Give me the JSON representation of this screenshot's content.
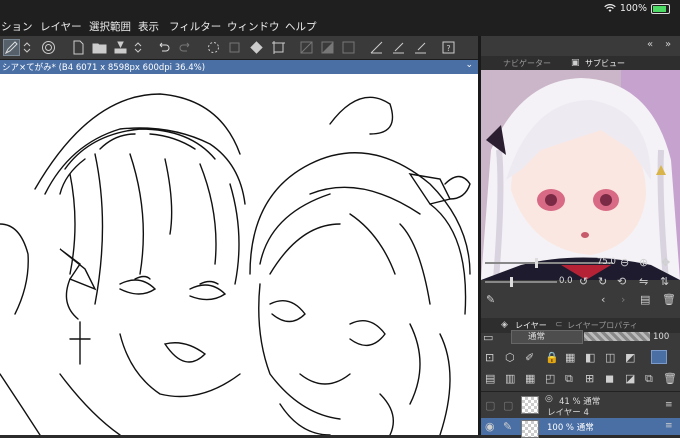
{
  "menubar": {
    "items": [
      "ション",
      "レイヤー",
      "選択範囲",
      "表示",
      "フィルター",
      "ウィンドウ",
      "ヘルプ"
    ],
    "battery_percent": "100%",
    "battery_level": 1.0
  },
  "document": {
    "title": "シア×てがみ* (B4 6071 x 8598px 600dpi 36.4%)"
  },
  "panel": {
    "tab_navigator": "ナビゲーター",
    "tab_subview": "サブビュー",
    "zoom_value": "75.0",
    "rotation_value": "0.0",
    "tab_layer": "レイヤー",
    "tab_layer_property": "レイヤープロパティ",
    "blend_mode": "通常",
    "opacity_value": "100"
  },
  "layers": [
    {
      "opacity_mode": "41 % 通常",
      "name": "レイヤー 4"
    },
    {
      "opacity_mode": "100 % 通常",
      "name": ""
    }
  ],
  "colors": {
    "menubar_bg": "#1f1f1f",
    "panel_bg": "#3a3a3a",
    "doc_tab_accent": "#4a6fa5",
    "selected_layer": "#4a6fa5",
    "battery": "#4cd964"
  }
}
